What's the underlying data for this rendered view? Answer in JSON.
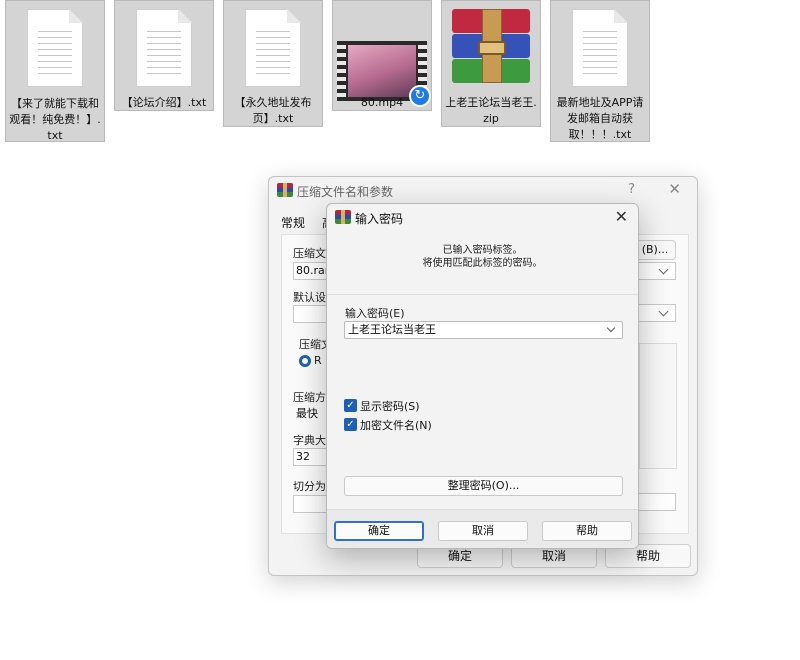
{
  "desktop_files": [
    {
      "name": "【来了就能下载和观看！纯免费！】.txt",
      "type": "txt"
    },
    {
      "name": "【论坛介绍】.txt",
      "type": "txt"
    },
    {
      "name": "【永久地址发布页】.txt",
      "type": "txt"
    },
    {
      "name": "80.mp4",
      "type": "video"
    },
    {
      "name": "上老王论坛当老王.zip",
      "type": "archive"
    },
    {
      "name": "最新地址及APP请发邮箱自动获取！！！.txt",
      "type": "txt"
    }
  ],
  "back_dialog": {
    "title": "压缩文件名和参数",
    "help_glyph": "?",
    "tab_general": "常规",
    "tab_second": "高",
    "label_archive_name": "压缩文件",
    "archive_name_value": "80.rar",
    "browse_button": "(B)...",
    "label_default_settings": "默认设置",
    "label_format": "压缩文",
    "radio_value": "R",
    "label_method": "压缩方",
    "method_value": "最快",
    "label_dict": "字典大小",
    "dict_value": "32",
    "label_split": "切分为分",
    "ok": "确定",
    "cancel": "取消",
    "help": "帮助"
  },
  "password_dialog": {
    "title": "输入密码",
    "message_line1": "已输入密码标签。",
    "message_line2": "将使用匹配此标签的密码。",
    "password_label": "输入密码(E)",
    "password_value": "上老王论坛当老王",
    "show_password_label": "显示密码(S)",
    "show_password_checked": true,
    "encrypt_names_label": "加密文件名(N)",
    "encrypt_names_checked": true,
    "organize_button": "整理密码(O)...",
    "ok": "确定",
    "cancel": "取消",
    "help": "帮助"
  },
  "colors": {
    "accent": "#1f5fb6",
    "dialog_bg": "#f3f3f3",
    "file_tile_bg": "#d4d4d4"
  }
}
